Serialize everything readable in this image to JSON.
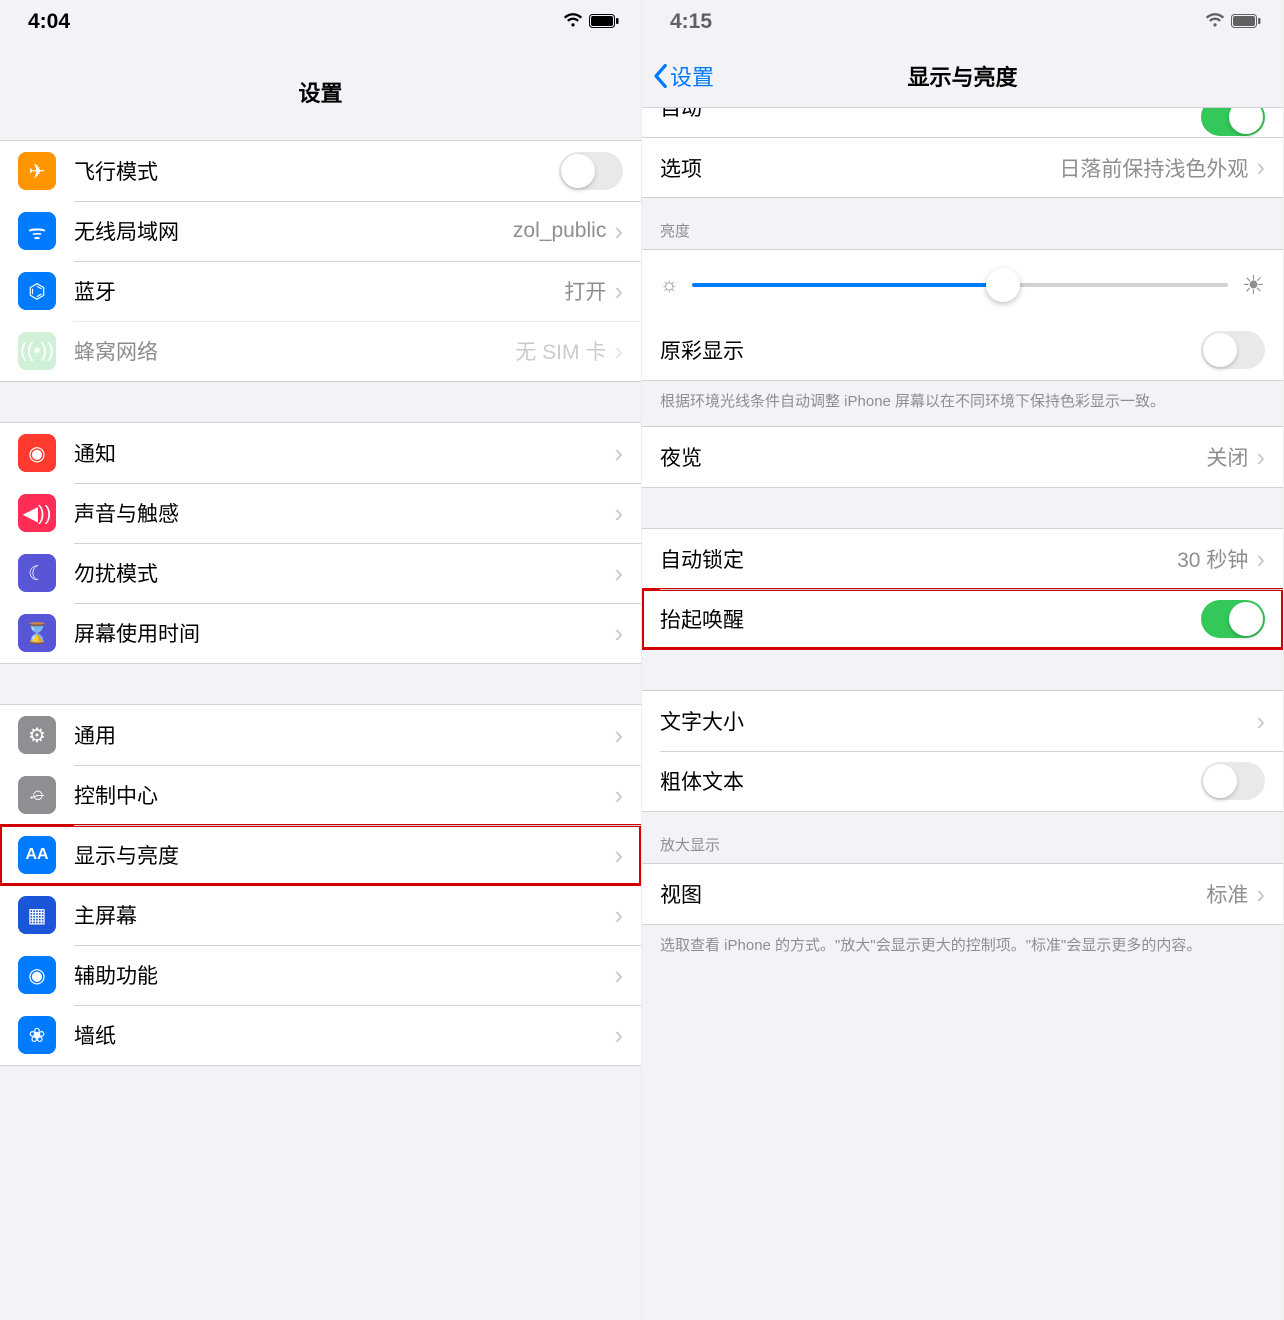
{
  "left": {
    "status": {
      "time": "4:04"
    },
    "nav": {
      "title": "设置"
    },
    "groups": [
      {
        "rows": [
          {
            "icon": "airplane-icon",
            "iconClass": "ic-orange",
            "glyph": "✈",
            "label": "飞行模式",
            "toggle": "off"
          },
          {
            "icon": "wifi-icon",
            "iconClass": "ic-blue",
            "glyph": "ᯤ",
            "label": "无线局域网",
            "value": "zol_public",
            "chevron": true
          },
          {
            "icon": "bluetooth-icon",
            "iconClass": "ic-blue",
            "glyph": "⌬",
            "label": "蓝牙",
            "value": "打开",
            "chevron": true
          },
          {
            "icon": "cellular-icon",
            "iconClass": "ic-green",
            "glyph": "((•))",
            "label": "蜂窝网络",
            "value": "无 SIM 卡",
            "chevron": true,
            "disabled": true
          }
        ]
      },
      {
        "rows": [
          {
            "icon": "notifications-icon",
            "iconClass": "ic-red",
            "glyph": "◉",
            "label": "通知",
            "chevron": true
          },
          {
            "icon": "sound-icon",
            "iconClass": "ic-pink",
            "glyph": "◀))",
            "label": "声音与触感",
            "chevron": true
          },
          {
            "icon": "dnd-icon",
            "iconClass": "ic-purple",
            "glyph": "☾",
            "label": "勿扰模式",
            "chevron": true
          },
          {
            "icon": "screentime-icon",
            "iconClass": "ic-purple",
            "glyph": "⌛",
            "label": "屏幕使用时间",
            "chevron": true
          }
        ]
      },
      {
        "rows": [
          {
            "icon": "general-icon",
            "iconClass": "ic-gray",
            "glyph": "⚙",
            "label": "通用",
            "chevron": true
          },
          {
            "icon": "control-center-icon",
            "iconClass": "ic-gray",
            "glyph": "⌮",
            "label": "控制中心",
            "chevron": true
          },
          {
            "icon": "display-icon",
            "iconClass": "ic-bluea",
            "glyph": "AA",
            "label": "显示与亮度",
            "chevron": true,
            "highlight": true
          },
          {
            "icon": "home-screen-icon",
            "iconClass": "ic-homeblue",
            "glyph": "▦",
            "label": "主屏幕",
            "chevron": true
          },
          {
            "icon": "accessibility-icon",
            "iconClass": "ic-blue",
            "glyph": "◉",
            "label": "辅助功能",
            "chevron": true
          },
          {
            "icon": "wallpaper-icon",
            "iconClass": "ic-blue",
            "glyph": "❀",
            "label": "墙纸",
            "chevron": true
          }
        ]
      }
    ]
  },
  "right": {
    "status": {
      "time": "4:15"
    },
    "nav": {
      "back": "设置",
      "title": "显示与亮度"
    },
    "partial_auto_label": "自动",
    "options_row": {
      "label": "选项",
      "value": "日落前保持浅色外观"
    },
    "brightness_header": "亮度",
    "true_tone": {
      "label": "原彩显示",
      "toggle": "off"
    },
    "true_tone_footer": "根据环境光线条件自动调整 iPhone 屏幕以在不同环境下保持色彩显示一致。",
    "night_shift": {
      "label": "夜览",
      "value": "关闭"
    },
    "auto_lock": {
      "label": "自动锁定",
      "value": "30 秒钟"
    },
    "raise_to_wake": {
      "label": "抬起唤醒",
      "toggle": "on",
      "highlight": true
    },
    "text_size": {
      "label": "文字大小"
    },
    "bold_text": {
      "label": "粗体文本",
      "toggle": "off"
    },
    "zoom_header": "放大显示",
    "view": {
      "label": "视图",
      "value": "标准"
    },
    "view_footer": "选取查看 iPhone 的方式。\"放大\"会显示更大的控制项。\"标准\"会显示更多的内容。"
  }
}
